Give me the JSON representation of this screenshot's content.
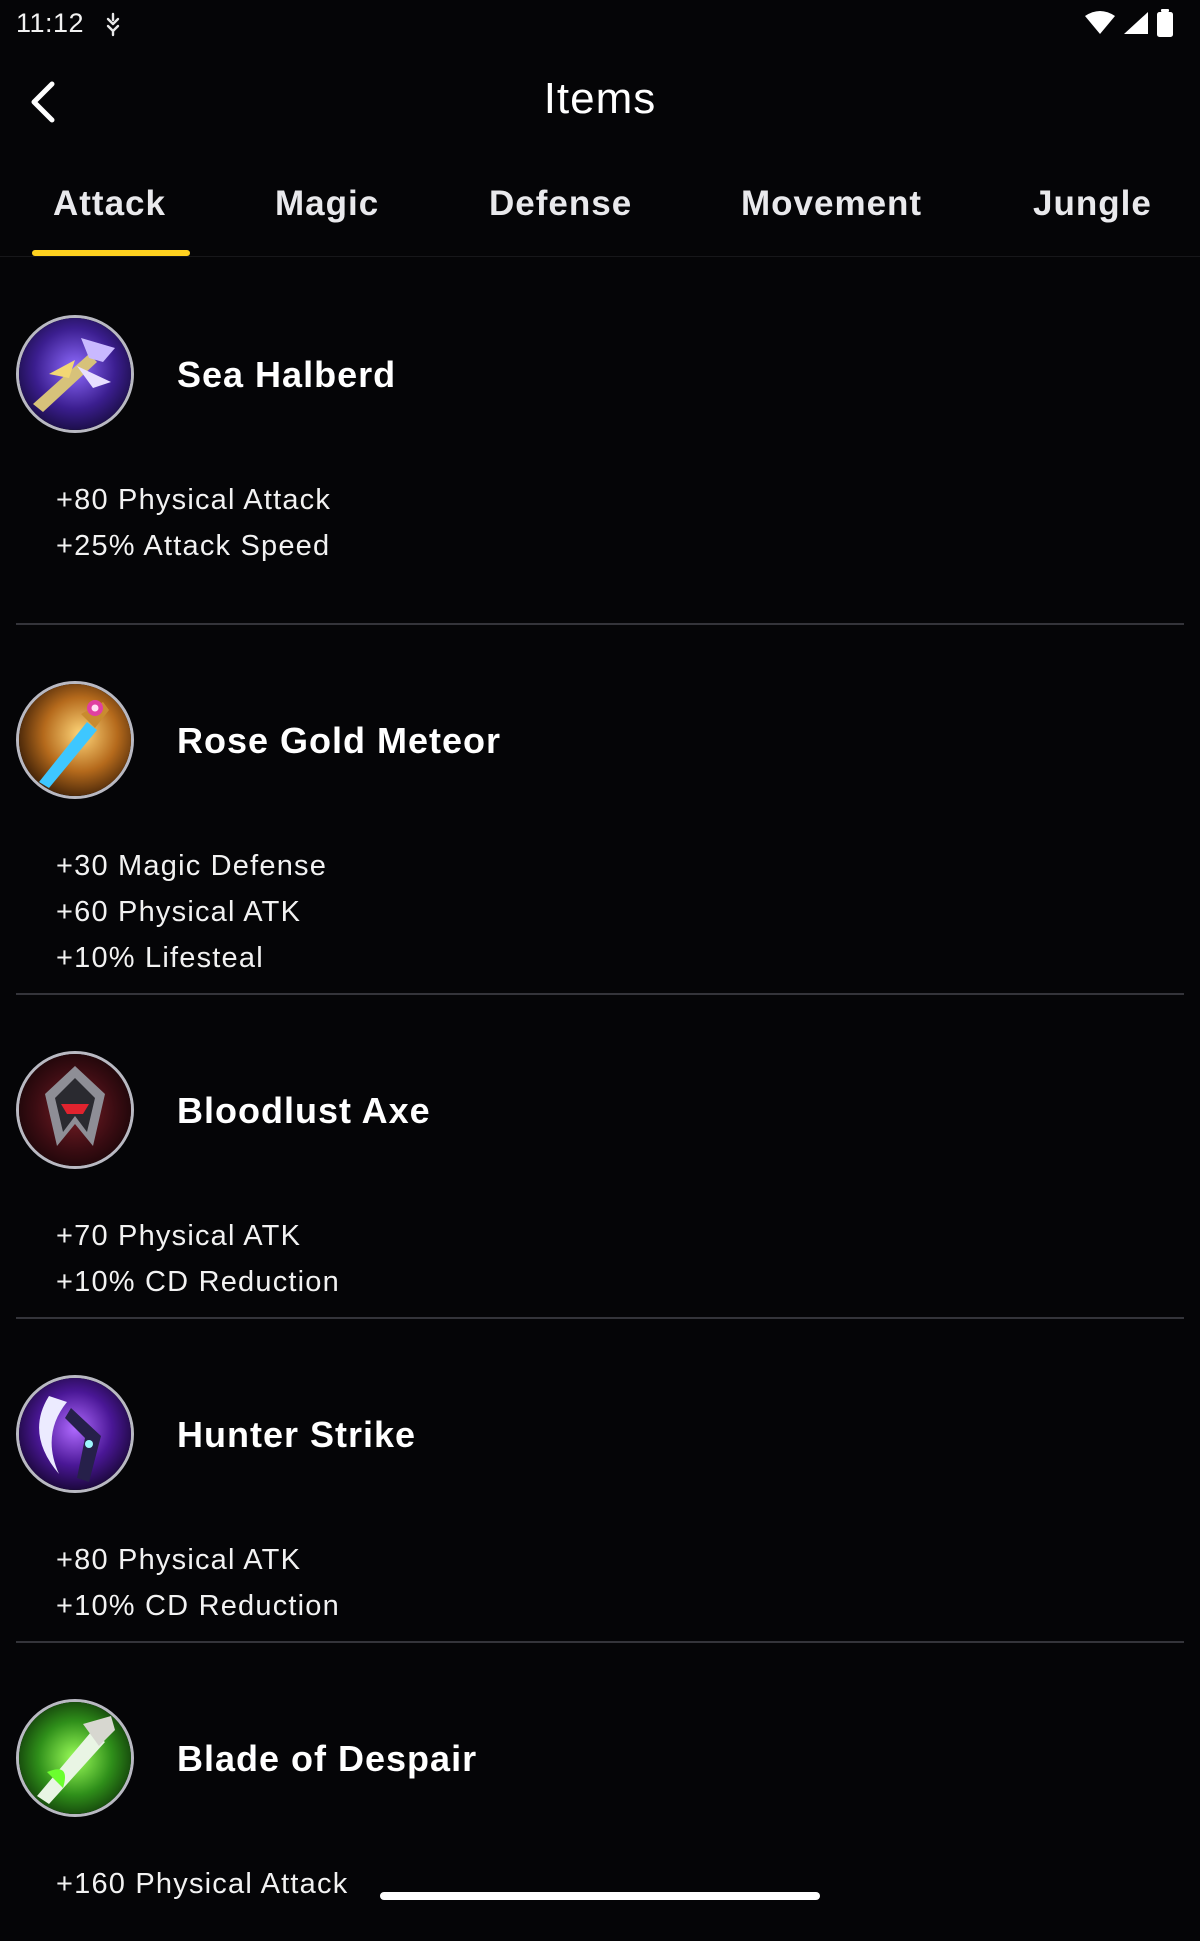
{
  "status_bar": {
    "time": "11:12",
    "icons": [
      "notification-icon",
      "wifi-icon",
      "signal-icon",
      "battery-icon"
    ]
  },
  "header": {
    "title": "Items",
    "back_icon": "chevron-left-icon"
  },
  "tabs": [
    {
      "label": "Attack",
      "selected": true
    },
    {
      "label": "Magic",
      "selected": false
    },
    {
      "label": "Defense",
      "selected": false
    },
    {
      "label": "Movement",
      "selected": false
    },
    {
      "label": "Jungle",
      "selected": false
    }
  ],
  "colors": {
    "background": "#050507",
    "accent": "#ffd21f",
    "divider": "#34343a",
    "text": "#ffffff"
  },
  "items": [
    {
      "name": "Sea Halberd",
      "icon": "halberd-icon",
      "stats": [
        "+80 Physical Attack",
        "+25% Attack Speed"
      ]
    },
    {
      "name": "Rose Gold Meteor",
      "icon": "meteor-sword-icon",
      "stats": [
        "+30 Magic Defense",
        "+60 Physical ATK",
        "+10% Lifesteal"
      ]
    },
    {
      "name": "Bloodlust Axe",
      "icon": "axe-icon",
      "stats": [
        "+70 Physical ATK",
        "+10% CD Reduction"
      ]
    },
    {
      "name": "Hunter Strike",
      "icon": "scythe-icon",
      "stats": [
        "+80 Physical ATK",
        "+10% CD Reduction"
      ]
    },
    {
      "name": "Blade of Despair",
      "icon": "blade-icon",
      "stats": [
        "+160 Physical Attack"
      ]
    }
  ]
}
